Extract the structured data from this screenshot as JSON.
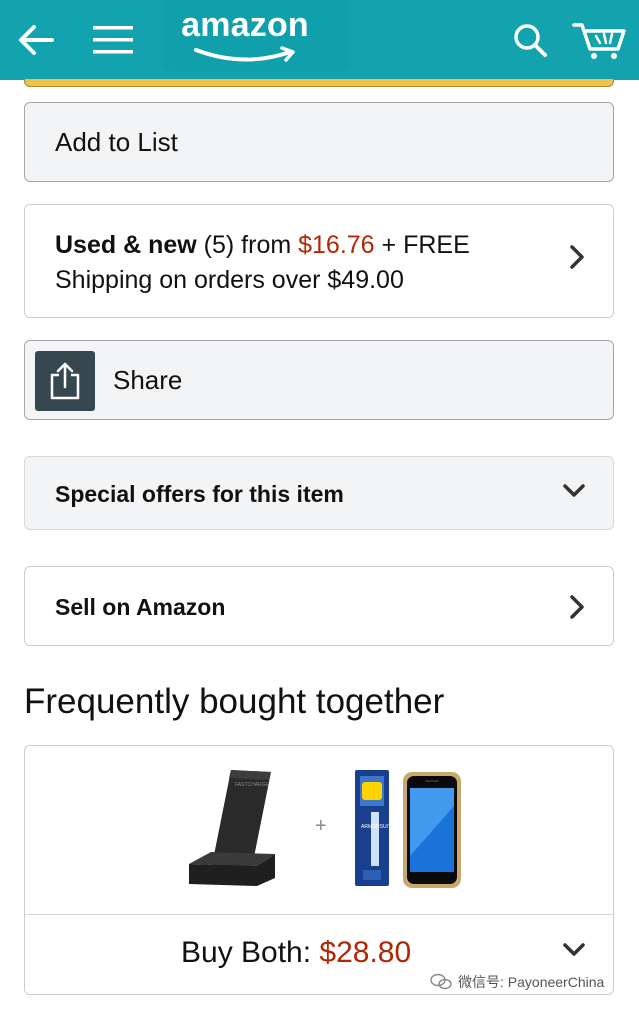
{
  "header": {
    "logo_text": "amazon",
    "icons": {
      "back": "back-arrow-icon",
      "menu": "hamburger-menu-icon",
      "search": "search-icon",
      "cart": "cart-icon"
    },
    "brand_color": "#12a3ae"
  },
  "add_to_list": {
    "label": "Add to List"
  },
  "used_new": {
    "label_bold": "Used & new",
    "count": "(5)",
    "from_text": "from",
    "price": "$16.76",
    "free_text": "+ FREE",
    "shipping_text": "Shipping on orders over $49.00",
    "price_color": "#b12704"
  },
  "share": {
    "label": "Share",
    "icon": "share-icon"
  },
  "special_offers": {
    "label": "Special offers for this item"
  },
  "sell_on_amazon": {
    "label": "Sell on Amazon"
  },
  "frequently_bought": {
    "title": "Frequently bought together",
    "items": [
      {
        "name": "wireless-charger-stand",
        "brand_text": "FASTCHARGE"
      },
      {
        "name": "screen-protector-pack",
        "brand_text": "ARMORSUIT"
      },
      {
        "name": "smartphone",
        "brand_text": ""
      }
    ],
    "plus": "+",
    "buy_both_label": "Buy Both:",
    "buy_both_price": "$28.80"
  },
  "watermark": {
    "text": "微信号: PayoneerChina"
  }
}
